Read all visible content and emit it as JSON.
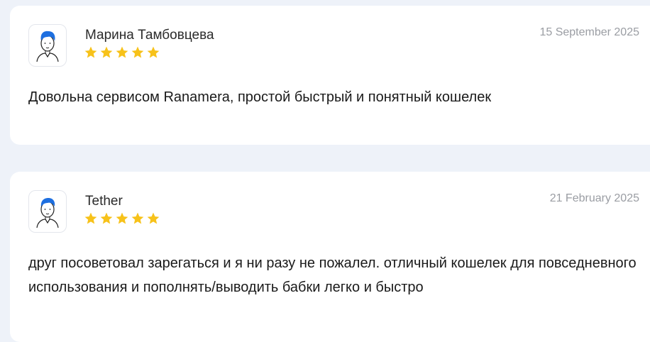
{
  "reviews": [
    {
      "author": "Марина Тамбовцева",
      "date": "15 September 2025",
      "rating": 5,
      "text": "Довольна сервисом Ranamera, простой быстрый и понятный кошелек",
      "avatar_icon": "user-avatar-icon"
    },
    {
      "author": "Tether",
      "date": "21 February 2025",
      "rating": 5,
      "text": "друг посоветовал зарегаться и я ни разу не пожалел. отличный кошелек для повседневного использования и пополнять/выводить бабки легко и быстро",
      "avatar_icon": "user-avatar-icon"
    }
  ],
  "colors": {
    "star": "#f7c21a",
    "background": "#eef2f9",
    "card": "#ffffff",
    "hair": "#1e6fe0"
  }
}
